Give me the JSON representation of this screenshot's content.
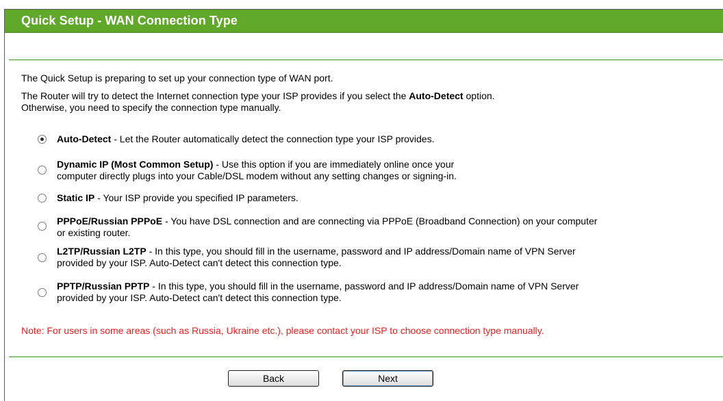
{
  "header": {
    "title": "Quick Setup - WAN Connection Type"
  },
  "intro": {
    "line1": "The Quick Setup is preparing to set up your connection type of WAN port.",
    "line2_prefix": "The Router will try to detect the Internet connection type your ISP provides if you select the ",
    "line2_bold": "Auto-Detect",
    "line2_suffix": " option.",
    "line3": "Otherwise, you need to specify the connection type manually."
  },
  "options": [
    {
      "name": "Auto-Detect",
      "desc": " - Let the Router automatically detect the connection type your ISP provides.",
      "desc2": "",
      "selected": true
    },
    {
      "name": "Dynamic IP (Most Common Setup)",
      "desc": " - Use this option if you are immediately online once your",
      "desc2": "computer directly plugs into your Cable/DSL modem without any setting changes or signing-in.",
      "selected": false
    },
    {
      "name": "Static IP",
      "desc": " - Your ISP provide you specified IP parameters.",
      "desc2": "",
      "selected": false
    },
    {
      "name": "PPPoE/Russian PPPoE",
      "desc": " - You have DSL connection and are connecting via PPPoE (Broadband Connection) on your computer",
      "desc2": "or existing router.",
      "selected": false
    },
    {
      "name": "L2TP/Russian L2TP",
      "desc": " - In this type, you should fill in the username, password and IP address/Domain name of VPN Server",
      "desc2": "provided by your ISP. Auto-Detect can't detect this connection type.",
      "selected": false
    },
    {
      "name": "PPTP/Russian PPTP",
      "desc": " - In this type, you should fill in the username, password and IP address/Domain name of VPN Server",
      "desc2": "provided by your ISP. Auto-Detect can't detect this connection type.",
      "selected": false
    }
  ],
  "note": "Note: For users in some areas (such as Russia, Ukraine etc.), please contact your ISP to choose connection type manually.",
  "buttons": {
    "back": "Back",
    "next": "Next"
  },
  "colors": {
    "header_bg": "#5fa829",
    "note_text": "#ff1a1a",
    "rule": "#3a8a22"
  }
}
